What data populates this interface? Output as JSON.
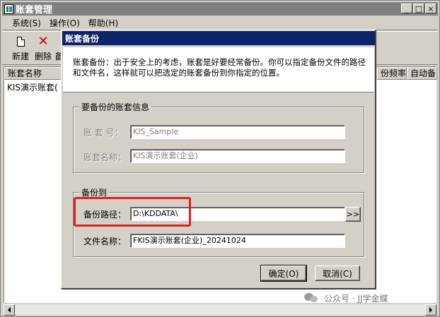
{
  "window": {
    "title": "账套管理",
    "controls": {
      "minimize": "_",
      "maximize": "□",
      "close": "×"
    }
  },
  "menu": {
    "items": [
      "系统(S)",
      "操作(O)",
      "帮助(H)"
    ]
  },
  "toolbar": {
    "new_label": "新建",
    "delete_label": "删除",
    "third_label": "备"
  },
  "list": {
    "columns": [
      "账套名称",
      "份频率",
      "自动备"
    ],
    "rows": [
      {
        "name": "KIS演示账套("
      }
    ]
  },
  "dialog": {
    "title": "账套备份",
    "description": "账套备份：出于安全上的考虑，账套是好要经常备份。你可以指定备份文件的路径和文件名，这样就可以把选定的账套备份到你指定的位置。",
    "info_group": {
      "legend": "要备份的账套信息",
      "account_no_label": "账 套 号：",
      "account_no_value": "KIS_Sample",
      "account_name_label": "账套名称：",
      "account_name_value": "KIS演示账套(企业)"
    },
    "backup_group": {
      "legend": "备份到",
      "path_label": "备份路径：",
      "path_value": "D:\\KDDATA\\",
      "browse_label": ">>",
      "filename_label": "文件名称：",
      "filename_value": "FKIS演示账套(企业)_20241024"
    },
    "ok_label": "确定(O)",
    "cancel_label": "取消(C)"
  },
  "watermark": {
    "text": "公众号 · JJ学金蝶"
  },
  "colors": {
    "dialog_title_bg": "#0a246a",
    "highlight": "#e0201e",
    "face": "#d4d0c8"
  }
}
